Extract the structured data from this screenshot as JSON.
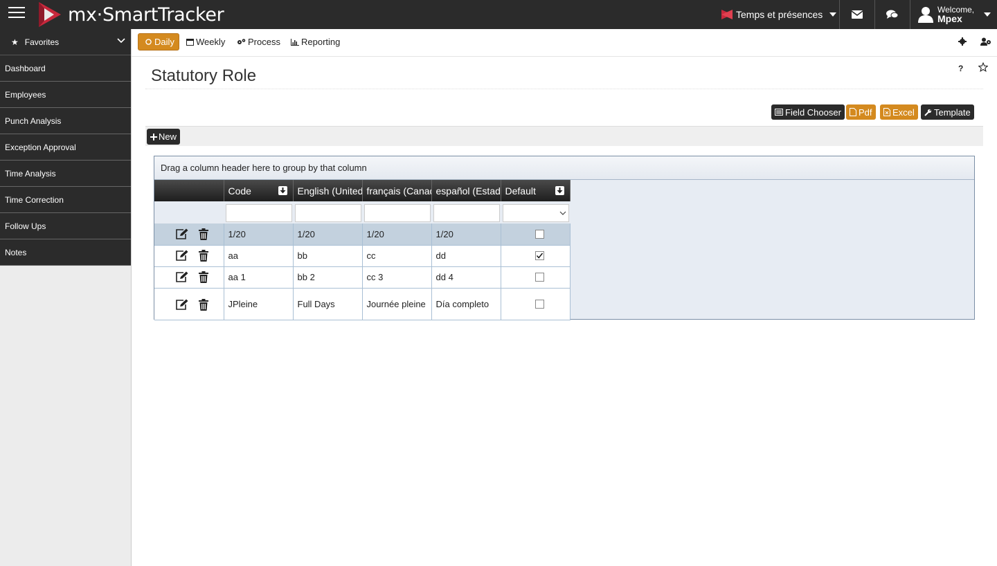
{
  "header": {
    "logo_text": "mx·SmartTracker",
    "app_selector": "Temps et présences",
    "welcome": "Welcome,",
    "user": "Mpex"
  },
  "sidebar": {
    "favorites": "Favorites",
    "items": [
      {
        "label": "Dashboard"
      },
      {
        "label": "Employees"
      },
      {
        "label": "Punch Analysis"
      },
      {
        "label": "Exception Approval"
      },
      {
        "label": "Time Analysis"
      },
      {
        "label": "Time Correction"
      },
      {
        "label": "Follow Ups"
      },
      {
        "label": "Notes"
      }
    ]
  },
  "subnav": {
    "daily": "Daily",
    "weekly": "Weekly",
    "process": "Process",
    "reporting": "Reporting"
  },
  "page": {
    "title": "Statutory Role",
    "help": "?"
  },
  "toolbar": {
    "field_chooser": "Field Chooser",
    "pdf": "Pdf",
    "excel": "Excel",
    "template": "Template",
    "new": "New"
  },
  "grid": {
    "group_hint": "Drag a column header here to group by that column",
    "columns": [
      "Code",
      "English (United",
      "français (Canad",
      "español (Estado",
      "Default"
    ],
    "rows": [
      {
        "code": "1/20",
        "en": "1/20",
        "fr": "1/20",
        "es": "1/20",
        "default": false
      },
      {
        "code": "aa",
        "en": "bb",
        "fr": "cc",
        "es": "dd",
        "default": true
      },
      {
        "code": "aa 1",
        "en": "bb 2",
        "fr": "cc 3",
        "es": "dd 4",
        "default": false
      },
      {
        "code": "JPleine",
        "en": "Full Days",
        "fr": "Journée pleine",
        "es": "Día completo",
        "default": false
      }
    ]
  },
  "colors": {
    "topbar": "#2b2b2b",
    "accent_orange": "#d48a1f",
    "selected_row": "#c3d1de",
    "grid_border": "#7a8ea5"
  }
}
